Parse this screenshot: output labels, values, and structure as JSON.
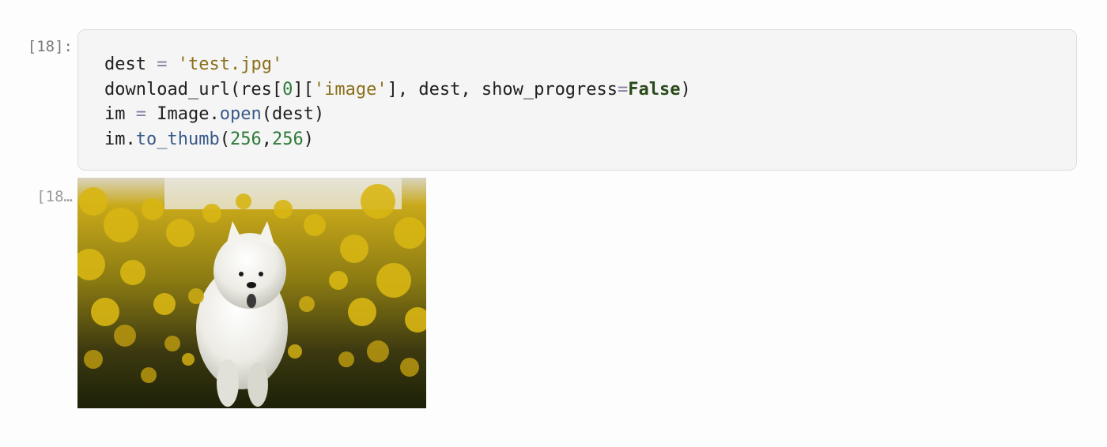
{
  "cell": {
    "input_prompt": "[18]:",
    "output_prompt": "[18…",
    "code": {
      "l1_var": "dest",
      "l1_eq": " = ",
      "l1_str": "'test.jpg'",
      "l2_fn": "download_url(res[",
      "l2_idx": "0",
      "l2_br": "][",
      "l2_key": "'image'",
      "l2_rest": "], dest, show_progress",
      "l2_eq": "=",
      "l2_kw": "False",
      "l2_close": ")",
      "l3_var": "im",
      "l3_eq": " = ",
      "l3_obj": "Image",
      "l3_dot": ".",
      "l3_fn": "open",
      "l3_args": "(dest)",
      "l4_var": "im",
      "l4_dot": ".",
      "l4_fn": "to_thumb",
      "l4_open": "(",
      "l4_n1": "256",
      "l4_comma": ",",
      "l4_n2": "256",
      "l4_close": ")"
    },
    "output_image": {
      "icon": "dog-in-flower-field-image"
    }
  }
}
